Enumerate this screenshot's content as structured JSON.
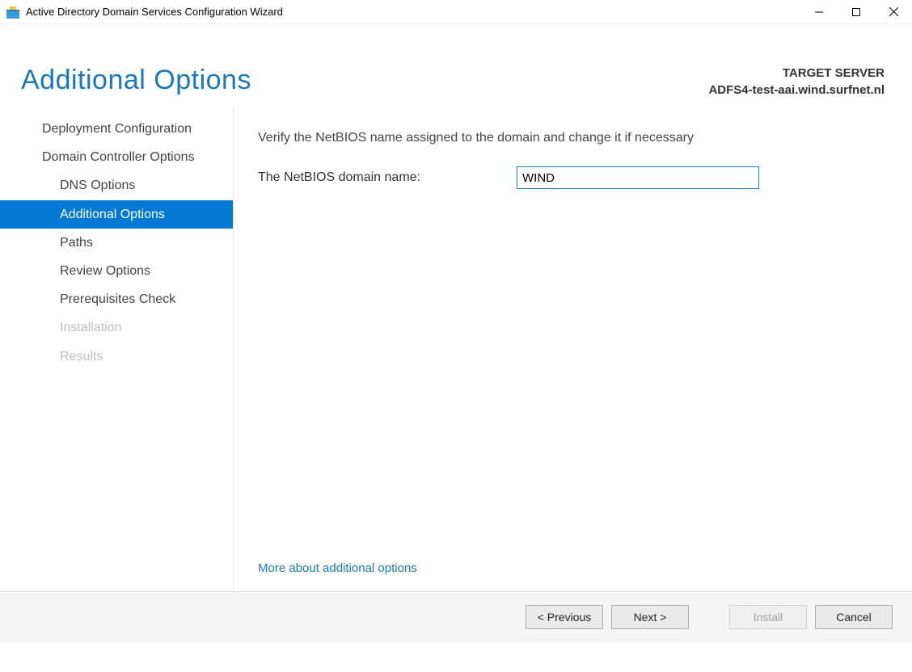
{
  "window": {
    "title": "Active Directory Domain Services Configuration Wizard"
  },
  "header": {
    "page_title": "Additional Options",
    "target_label": "TARGET SERVER",
    "target_value": "ADFS4-test-aai.wind.surfnet.nl"
  },
  "sidebar": {
    "items": [
      {
        "label": "Deployment Configuration",
        "level": "top",
        "state": "normal"
      },
      {
        "label": "Domain Controller Options",
        "level": "top",
        "state": "normal"
      },
      {
        "label": "DNS Options",
        "level": "sub",
        "state": "normal"
      },
      {
        "label": "Additional Options",
        "level": "sub",
        "state": "selected"
      },
      {
        "label": "Paths",
        "level": "sub",
        "state": "normal"
      },
      {
        "label": "Review Options",
        "level": "sub",
        "state": "normal"
      },
      {
        "label": "Prerequisites Check",
        "level": "sub",
        "state": "normal"
      },
      {
        "label": "Installation",
        "level": "sub",
        "state": "disabled"
      },
      {
        "label": "Results",
        "level": "sub",
        "state": "disabled"
      }
    ]
  },
  "content": {
    "instruction": "Verify the NetBIOS name assigned to the domain and change it if necessary",
    "field_label": "The NetBIOS domain name:",
    "field_value": "WIND",
    "more_link": "More about additional options"
  },
  "footer": {
    "previous": "< Previous",
    "next": "Next >",
    "install": "Install",
    "cancel": "Cancel"
  }
}
